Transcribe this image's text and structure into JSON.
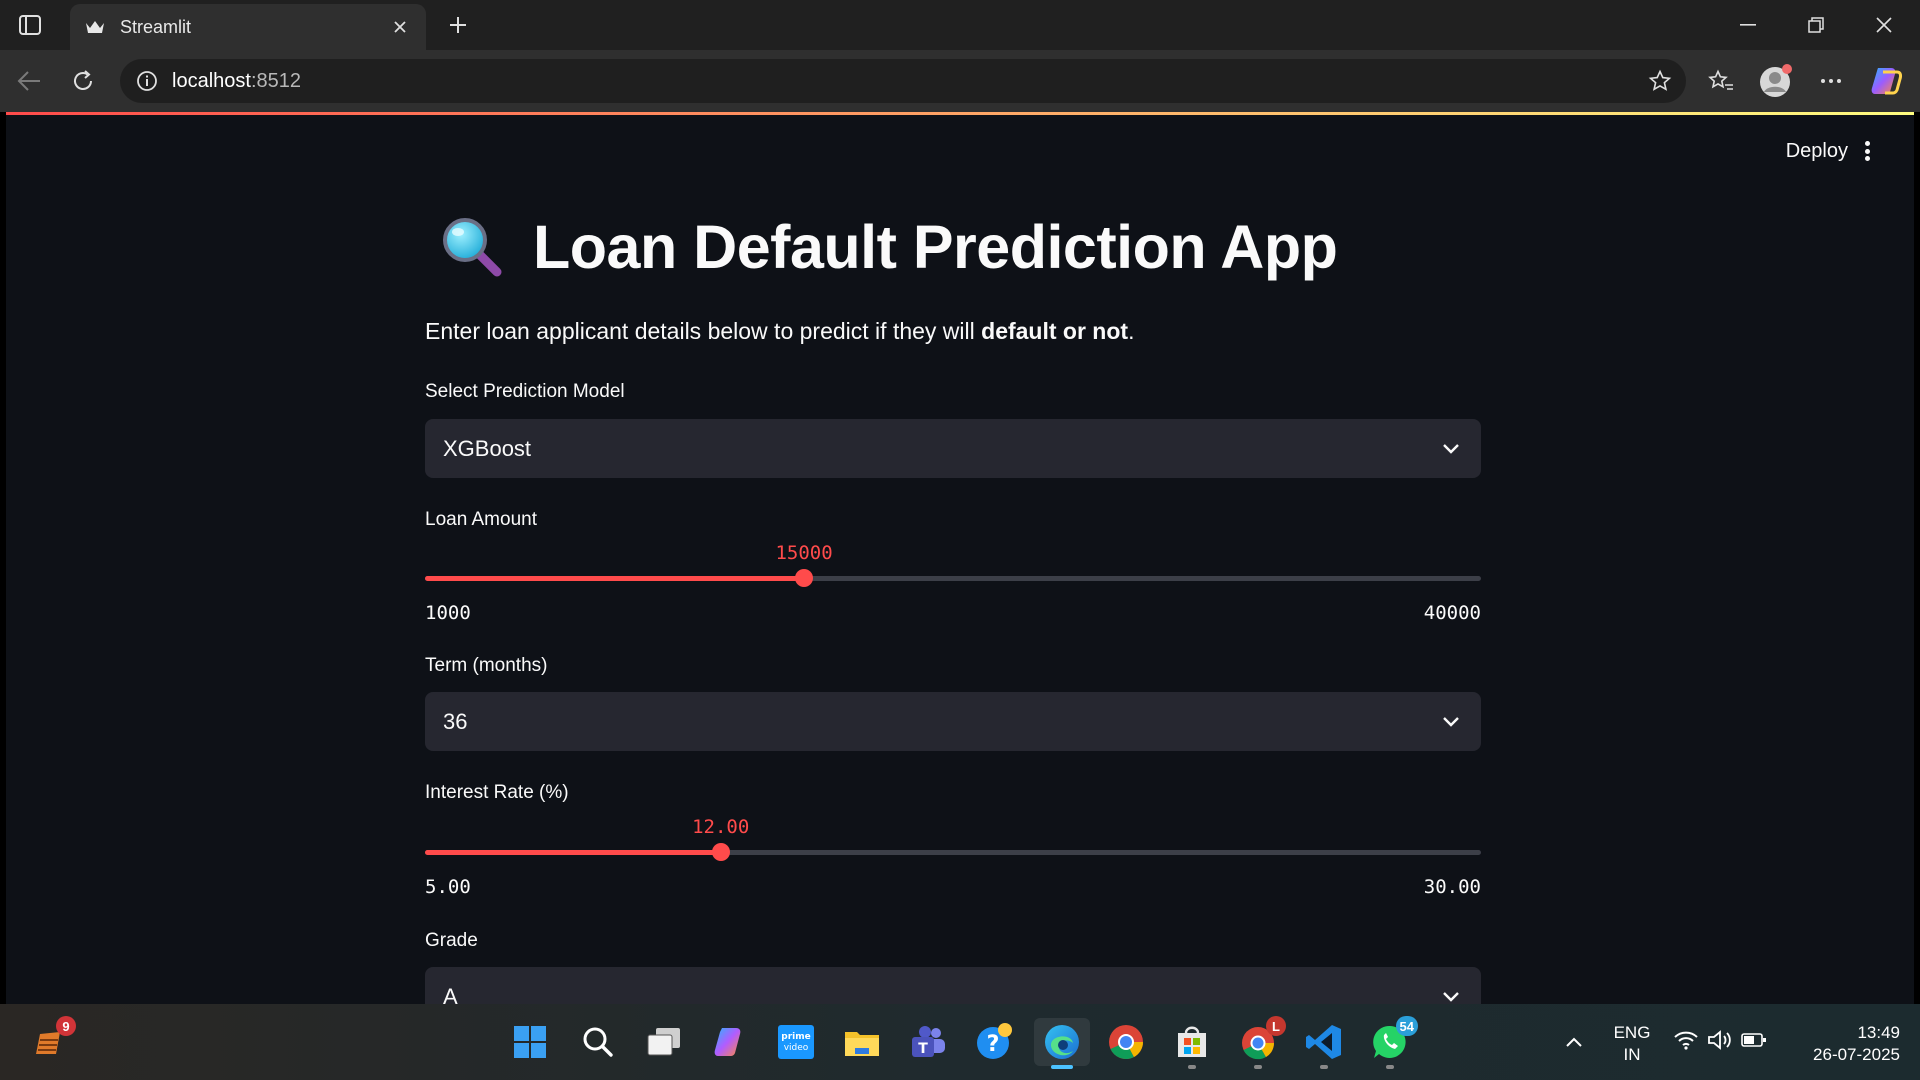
{
  "browser": {
    "tab_title": "Streamlit",
    "address_host": "localhost",
    "address_port": ":8512"
  },
  "header": {
    "deploy_label": "Deploy"
  },
  "main": {
    "title": "Loan Default Prediction App",
    "subtitle_prefix": "Enter loan applicant details below to predict if they will ",
    "subtitle_bold": "default or not",
    "subtitle_suffix": ".",
    "model_select": {
      "label": "Select Prediction Model",
      "value": "XGBoost"
    },
    "loan_amount": {
      "label": "Loan Amount",
      "value": "15000",
      "min": "1000",
      "max": "40000",
      "fraction": 0.359
    },
    "term_select": {
      "label": "Term (months)",
      "value": "36"
    },
    "interest_rate": {
      "label": "Interest Rate (%)",
      "value": "12.00",
      "min": "5.00",
      "max": "30.00",
      "fraction": 0.28
    },
    "grade_select": {
      "label": "Grade",
      "value": "A"
    }
  },
  "taskbar": {
    "widget_badge": "9",
    "chrome_profile_badge": "L",
    "whatsapp_badge": "54",
    "lang_line1": "ENG",
    "lang_line2": "IN",
    "time": "13:49",
    "date": "26-07-2025"
  },
  "colors": {
    "accent": "#ff4b4b",
    "page_bg": "#0e1117",
    "input_bg": "#262730"
  }
}
